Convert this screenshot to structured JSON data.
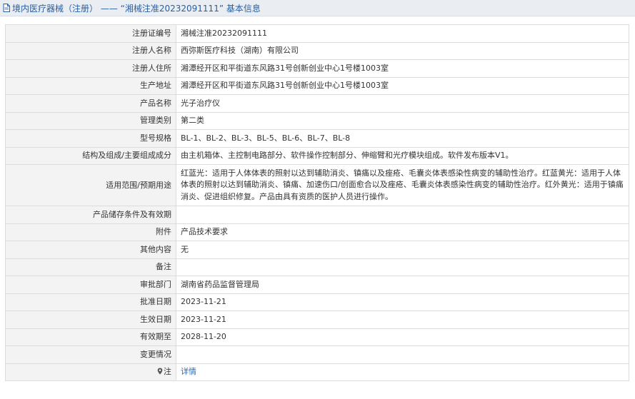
{
  "header": {
    "title": "境内医疗器械（注册） —— “湘械注准20232091111” 基本信息"
  },
  "rows": [
    {
      "label": "注册证编号",
      "value": "湘械注准20232091111"
    },
    {
      "label": "注册人名称",
      "value": "西弥斯医疗科技（湖南）有限公司"
    },
    {
      "label": "注册人住所",
      "value": "湘潭经开区和平街道东风路31号创新创业中心1号楼1003室"
    },
    {
      "label": "生产地址",
      "value": "湘潭经开区和平街道东风路31号创新创业中心1号楼1003室"
    },
    {
      "label": "产品名称",
      "value": "光子治疗仪"
    },
    {
      "label": "管理类别",
      "value": "第二类"
    },
    {
      "label": "型号规格",
      "value": "BL-1、BL-2、BL-3、BL-5、BL-6、BL-7、BL-8"
    },
    {
      "label": "结构及组成/主要组成成分",
      "value": "由主机箱体、主控制电路部分、软件操作控制部分、伸缩臂和光疗模块组成。软件发布版本V1。"
    },
    {
      "label": "适用范围/预期用途",
      "value": "红蓝光：适用于人体体表的照射以达到辅助消炎、镇痛以及痤疮、毛囊炎体表感染性病变的辅助性治疗。红蓝黄光：适用于人体体表的照射以达到辅助消炎、镇痛、加速伤口/创面愈合以及痤疮、毛囊炎体表感染性病变的辅助性治疗。红外黄光：适用于镇痛消炎、促进组织修复。产品由具有资质的医护人员进行操作。"
    },
    {
      "label": "产品储存条件及有效期",
      "value": ""
    },
    {
      "label": "附件",
      "value": "产品技术要求"
    },
    {
      "label": "其他内容",
      "value": "无"
    },
    {
      "label": "备注",
      "value": ""
    },
    {
      "label": "审批部门",
      "value": "湖南省药品监督管理局"
    },
    {
      "label": "批准日期",
      "value": "2023-11-21"
    },
    {
      "label": "生效日期",
      "value": "2023-11-21"
    },
    {
      "label": "有效期至",
      "value": "2028-11-20"
    },
    {
      "label": "变更情况",
      "value": ""
    }
  ],
  "note": {
    "label": "注",
    "icon": "pin-icon",
    "link_text": "详情"
  }
}
